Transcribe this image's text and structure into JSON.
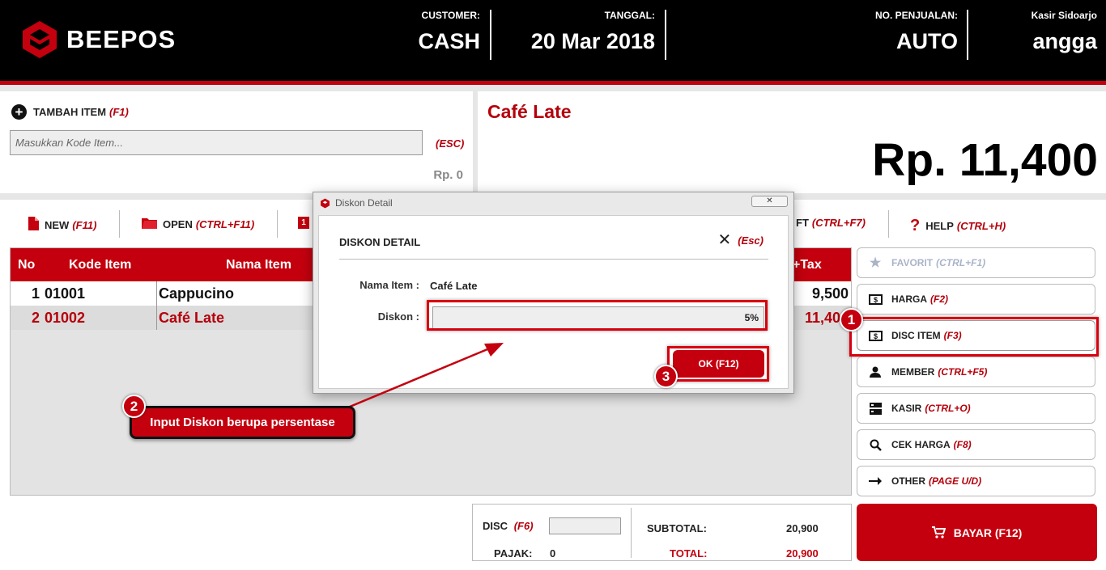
{
  "header": {
    "brand": "BEEPOS",
    "customer_label": "CUSTOMER:",
    "customer_value": "CASH",
    "date_label": "TANGGAL:",
    "date_value": "20 Mar 2018",
    "sale_no_label": "NO. PENJUALAN:",
    "sale_no_value": "AUTO",
    "cashier_label": "Kasir Sidoarjo",
    "cashier_value": "angga"
  },
  "add_item": {
    "title": "TAMBAH ITEM",
    "hotkey": "(F1)",
    "placeholder": "Masukkan Kode Item...",
    "esc_hint": "(ESC)",
    "subtotal": "Rp. 0"
  },
  "current_item": {
    "name": "Café Late",
    "price": "Rp. 11,400"
  },
  "toolbar": {
    "new_label": "NEW",
    "new_hotkey": "(F11)",
    "open_label": "OPEN",
    "open_hotkey": "(CTRL+F11)",
    "third_icon_text": "1",
    "partial_label": "FT",
    "partial_hotkey": "(CTRL+F7)",
    "help_label": "HELP",
    "help_hotkey": "(CTRL+H)"
  },
  "table": {
    "headers": [
      "No",
      "Kode Item",
      "Nama Item",
      "+Tax"
    ],
    "rows": [
      {
        "no": "1",
        "code": "01001",
        "name": "Cappucino",
        "total": "9,500"
      },
      {
        "no": "2",
        "code": "01002",
        "name": "Café Late",
        "total": "11,40"
      }
    ]
  },
  "side_buttons": [
    {
      "label": "FAVORIT",
      "hotkey": "(CTRL+F1)",
      "icon": "star-icon"
    },
    {
      "label": "HARGA",
      "hotkey": "(F2)",
      "icon": "price-tag-icon"
    },
    {
      "label": "DISC ITEM",
      "hotkey": "(F3)",
      "icon": "discount-icon"
    },
    {
      "label": "MEMBER",
      "hotkey": "(CTRL+F5)",
      "icon": "user-icon"
    },
    {
      "label": "KASIR",
      "hotkey": "(CTRL+O)",
      "icon": "cashier-icon"
    },
    {
      "label": "CEK HARGA",
      "hotkey": "(F8)",
      "icon": "search-icon"
    },
    {
      "label": "OTHER",
      "hotkey": "(PAGE U/D)",
      "icon": "arrow-right-icon"
    }
  ],
  "pay_button": {
    "label": "BAYAR (F12)"
  },
  "totals": {
    "disc_label": "DISC",
    "disc_hotkey": "(F6)",
    "tax_label": "PAJAK:",
    "tax_value": "0",
    "subtotal_label": "SUBTOTAL:",
    "subtotal_value": "20,900",
    "total_label": "TOTAL:",
    "total_value": "20,900"
  },
  "modal": {
    "window_title": "Diskon Detail",
    "heading": "DISKON DETAIL",
    "close_hint": "(Esc)",
    "item_name_label": "Nama Item :",
    "item_name_value": "Café Late",
    "discount_label": "Diskon :",
    "discount_value": "5%",
    "ok_label": "OK (F12)"
  },
  "annotations": {
    "badge1": "1",
    "badge2": "2",
    "badge3": "3",
    "callout": "Input Diskon berupa persentase"
  },
  "colors": {
    "brand_red": "#c4000e",
    "header_bg": "#000000",
    "hotkey_red": "#b5000b"
  }
}
